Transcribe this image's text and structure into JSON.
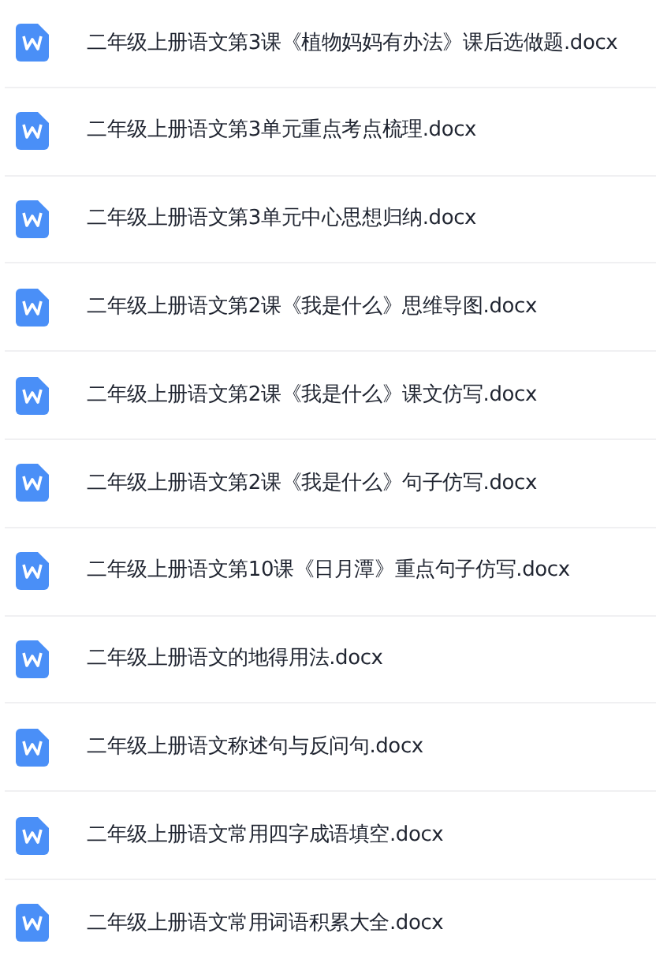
{
  "files": [
    {
      "name": "二年级上册语文第3课《植物妈妈有办法》课后选做题.docx"
    },
    {
      "name": "二年级上册语文第3单元重点考点梳理.docx"
    },
    {
      "name": "二年级上册语文第3单元中心思想归纳.docx"
    },
    {
      "name": "二年级上册语文第2课《我是什么》思维导图.docx"
    },
    {
      "name": "二年级上册语文第2课《我是什么》课文仿写.docx"
    },
    {
      "name": "二年级上册语文第2课《我是什么》句子仿写.docx"
    },
    {
      "name": "二年级上册语文第10课《日月潭》重点句子仿写.docx"
    },
    {
      "name": "二年级上册语文的地得用法.docx"
    },
    {
      "name": "二年级上册语文称述句与反问句.docx"
    },
    {
      "name": "二年级上册语文常用四字成语填空.docx"
    },
    {
      "name": "二年级上册语文常用词语积累大全.docx"
    }
  ]
}
